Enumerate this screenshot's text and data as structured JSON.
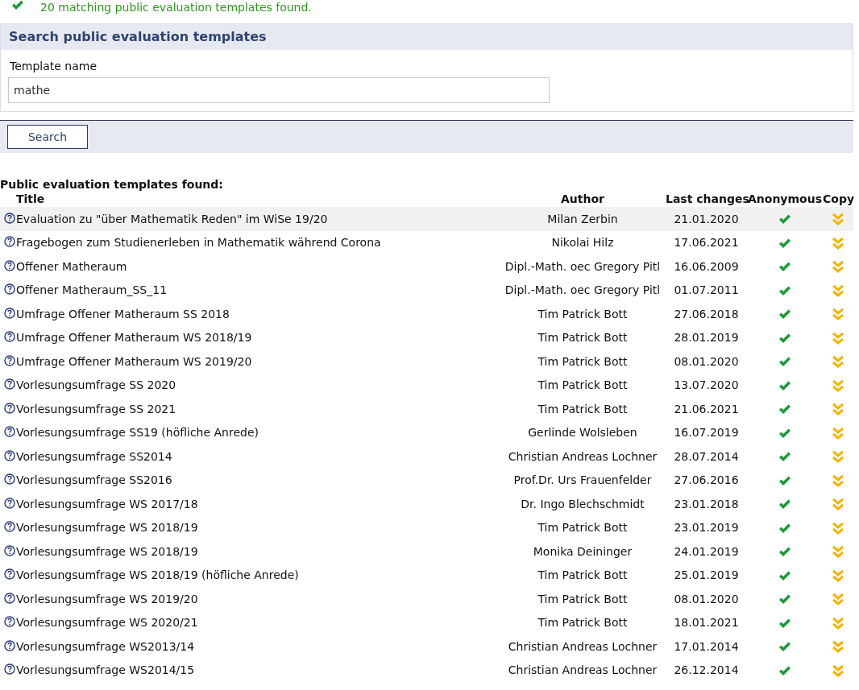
{
  "message": {
    "text": "20 matching public evaluation templates found."
  },
  "search_panel": {
    "title": "Search public evaluation templates",
    "field_label": "Template name",
    "field_value": "mathe",
    "button": "Search"
  },
  "results": {
    "heading": "Public evaluation templates found:",
    "columns": [
      "Title",
      "Author",
      "Last changes",
      "Anonymous",
      "Copy"
    ],
    "rows": [
      {
        "title": "Evaluation zu \"über Mathematik Reden\" im WiSe 19/20",
        "author": "Milan Zerbin",
        "date": "21.01.2020",
        "anonymous": true,
        "highlighted": true
      },
      {
        "title": "Fragebogen zum Studienerleben in Mathematik während Corona",
        "author": "Nikolai Hilz",
        "date": "17.06.2021",
        "anonymous": true,
        "highlighted": false
      },
      {
        "title": "Offener Matheraum",
        "author": "Dipl.-Math. oec Gregory Pitl",
        "date": "16.06.2009",
        "anonymous": true,
        "highlighted": false
      },
      {
        "title": "Offener Matheraum_SS_11",
        "author": "Dipl.-Math. oec Gregory Pitl",
        "date": "01.07.2011",
        "anonymous": true,
        "highlighted": false
      },
      {
        "title": "Umfrage Offener Matheraum SS 2018",
        "author": "Tim Patrick Bott",
        "date": "27.06.2018",
        "anonymous": true,
        "highlighted": false
      },
      {
        "title": "Umfrage Offener Matheraum WS 2018/19",
        "author": "Tim Patrick Bott",
        "date": "28.01.2019",
        "anonymous": true,
        "highlighted": false
      },
      {
        "title": "Umfrage Offener Matheraum WS 2019/20",
        "author": "Tim Patrick Bott",
        "date": "08.01.2020",
        "anonymous": true,
        "highlighted": false
      },
      {
        "title": "Vorlesungsumfrage SS 2020",
        "author": "Tim Patrick Bott",
        "date": "13.07.2020",
        "anonymous": true,
        "highlighted": false
      },
      {
        "title": "Vorlesungsumfrage SS 2021",
        "author": "Tim Patrick Bott",
        "date": "21.06.2021",
        "anonymous": true,
        "highlighted": false
      },
      {
        "title": "Vorlesungsumfrage SS19 (höfliche Anrede)",
        "author": "Gerlinde Wolsleben",
        "date": "16.07.2019",
        "anonymous": true,
        "highlighted": false
      },
      {
        "title": "Vorlesungsumfrage SS2014",
        "author": "Christian Andreas Lochner",
        "date": "28.07.2014",
        "anonymous": true,
        "highlighted": false
      },
      {
        "title": "Vorlesungsumfrage SS2016",
        "author": "Prof.Dr. Urs Frauenfelder",
        "date": "27.06.2016",
        "anonymous": true,
        "highlighted": false
      },
      {
        "title": "Vorlesungsumfrage WS 2017/18",
        "author": "Dr. Ingo Blechschmidt",
        "date": "23.01.2018",
        "anonymous": true,
        "highlighted": false
      },
      {
        "title": "Vorlesungsumfrage WS 2018/19",
        "author": "Tim Patrick Bott",
        "date": "23.01.2019",
        "anonymous": true,
        "highlighted": false
      },
      {
        "title": "Vorlesungsumfrage WS 2018/19",
        "author": "Monika Deininger",
        "date": "24.01.2019",
        "anonymous": true,
        "highlighted": false
      },
      {
        "title": "Vorlesungsumfrage WS 2018/19 (höfliche Anrede)",
        "author": "Tim Patrick Bott",
        "date": "25.01.2019",
        "anonymous": true,
        "highlighted": false
      },
      {
        "title": "Vorlesungsumfrage WS 2019/20",
        "author": "Tim Patrick Bott",
        "date": "08.01.2020",
        "anonymous": true,
        "highlighted": false
      },
      {
        "title": "Vorlesungsumfrage WS 2020/21",
        "author": "Tim Patrick Bott",
        "date": "18.01.2021",
        "anonymous": true,
        "highlighted": false
      },
      {
        "title": "Vorlesungsumfrage WS2013/14",
        "author": "Christian Andreas Lochner",
        "date": "17.01.2014",
        "anonymous": true,
        "highlighted": false
      },
      {
        "title": "Vorlesungsumfrage WS2014/15",
        "author": "Christian Andreas Lochner",
        "date": "26.12.2014",
        "anonymous": true,
        "highlighted": false
      }
    ]
  }
}
